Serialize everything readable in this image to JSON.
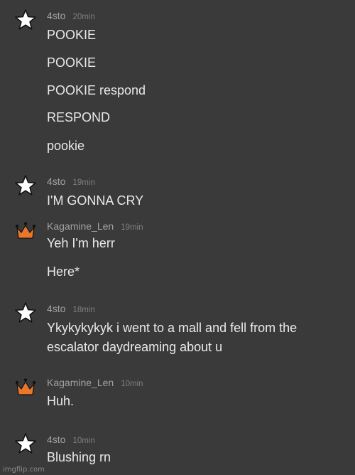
{
  "colors": {
    "background": "#3a3a3a",
    "text": "#e9e9e9",
    "username": "#a2a2a2",
    "timestamp": "#7f7f7f",
    "crown": "#e8762b",
    "star": "#ffffff"
  },
  "messages": [
    {
      "user": "4sto",
      "time": "20min",
      "avatar_icon": "star-icon",
      "lines": [
        "POOKIE",
        "POOKIE",
        "POOKIE respond",
        "RESPOND",
        "pookie"
      ]
    },
    {
      "user": "4sto",
      "time": "19min",
      "avatar_icon": "star-icon",
      "lines": [
        "I'M GONNA CRY"
      ]
    },
    {
      "user": "Kagamine_Len",
      "time": "19min",
      "avatar_icon": "crown-icon",
      "lines": [
        "Yeh I'm herr",
        "Here*"
      ]
    },
    {
      "user": "4sto",
      "time": "18min",
      "avatar_icon": "star-icon",
      "lines": [
        "Ykykykykyk i went to a mall and fell from the",
        "escalator daydreaming about u"
      ]
    },
    {
      "user": "Kagamine_Len",
      "time": "10min",
      "avatar_icon": "crown-icon",
      "lines": [
        "Huh."
      ]
    },
    {
      "user": "4sto",
      "time": "10min",
      "avatar_icon": "star-icon",
      "lines": [
        "Blushing rn"
      ]
    }
  ],
  "watermark": "imgflip.com"
}
